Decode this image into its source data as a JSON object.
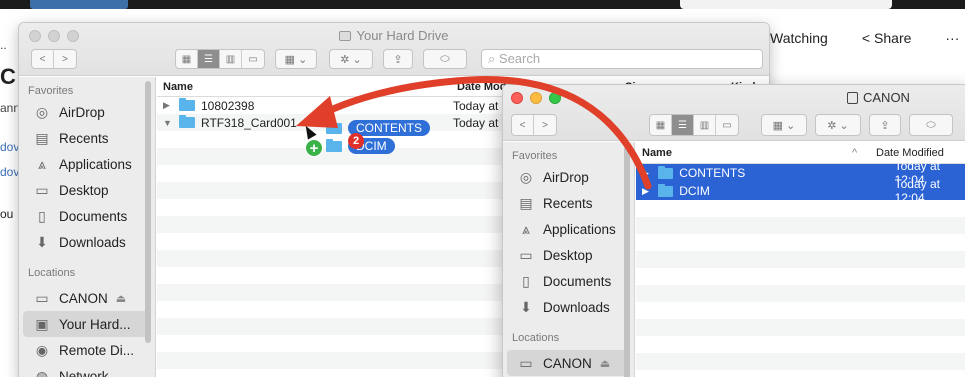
{
  "background": {
    "actions": {
      "watching": "Watching",
      "share": "Share",
      "more": "···"
    },
    "fragments": {
      "f1": "..",
      "f2": "C",
      "f3": "ann",
      "f4": "dov",
      "f5": "dov",
      "f6": "ou"
    }
  },
  "window1": {
    "title": "Your Hard Drive",
    "search_placeholder": "Search",
    "sidebar": {
      "favorites_header": "Favorites",
      "favorites": [
        "AirDrop",
        "Recents",
        "Applications",
        "Desktop",
        "Documents",
        "Downloads"
      ],
      "locations_header": "Locations",
      "locations": [
        "CANON",
        "Your Hard...",
        "Remote Di...",
        "Network"
      ]
    },
    "columns": {
      "name": "Name",
      "date": "Date Modified",
      "size": "Size",
      "kind": "Kind"
    },
    "rows": [
      {
        "name": "10802398",
        "date": "Today at",
        "expanded": false
      },
      {
        "name": "RTF318_Card001",
        "date": "Today at",
        "expanded": true
      }
    ]
  },
  "drag": {
    "items": [
      "CONTENTS",
      "DCIM"
    ],
    "count": "2",
    "plus": "+"
  },
  "window2": {
    "title": "CANON",
    "sidebar": {
      "favorites_header": "Favorites",
      "favorites": [
        "AirDrop",
        "Recents",
        "Applications",
        "Desktop",
        "Documents",
        "Downloads"
      ],
      "locations_header": "Locations",
      "locations": [
        "CANON"
      ]
    },
    "columns": {
      "name": "Name",
      "date": "Date Modified"
    },
    "rows": [
      {
        "name": "CONTENTS",
        "date": "Today at 12:04",
        "selected": true
      },
      {
        "name": "DCIM",
        "date": "Today at 12:04",
        "selected": true
      }
    ]
  },
  "colors": {
    "selection": "#2b63d5",
    "folder": "#5ab4ec",
    "arrow": "#e0402a"
  }
}
